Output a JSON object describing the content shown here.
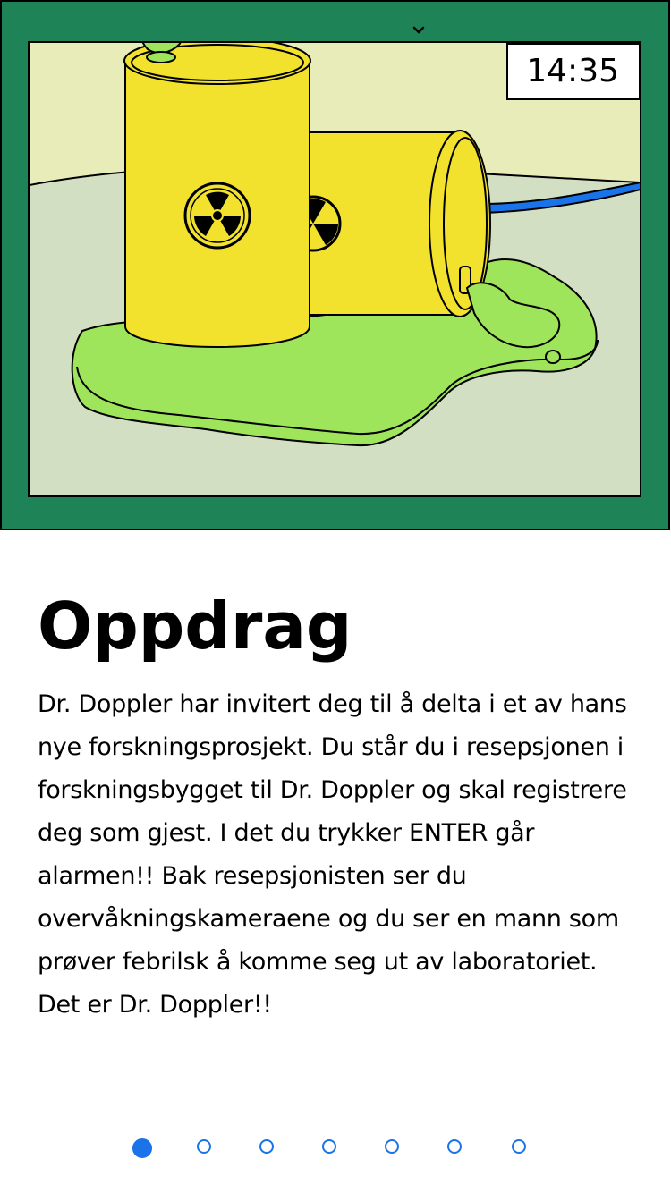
{
  "scene": {
    "clock": "14:35",
    "chevron_icon": "chevron-down-icon",
    "frame_color": "#1f8358",
    "barrel_color": "#f2e22e",
    "goo_color": "#9fe55c",
    "floor_color": "#d3dfc3",
    "wall_color": "#e8ecb9",
    "pipe_color": "#1a73e8"
  },
  "content": {
    "title": "Oppdrag",
    "body": "Dr. Doppler har invitert deg til å delta i et av hans nye forskningsprosjekt. Du står du i resepsjonen i forskningsbygget til Dr. Doppler og skal registrere deg som gjest. I det du trykker ENTER går alarmen!! Bak resepsjonisten ser du overvåkningskameraene og du ser en mann som prøver febrilsk å komme seg ut av laboratoriet. Det er Dr. Doppler!!"
  },
  "pagination": {
    "total": 7,
    "active": 1,
    "accent": "#1a73e8"
  }
}
